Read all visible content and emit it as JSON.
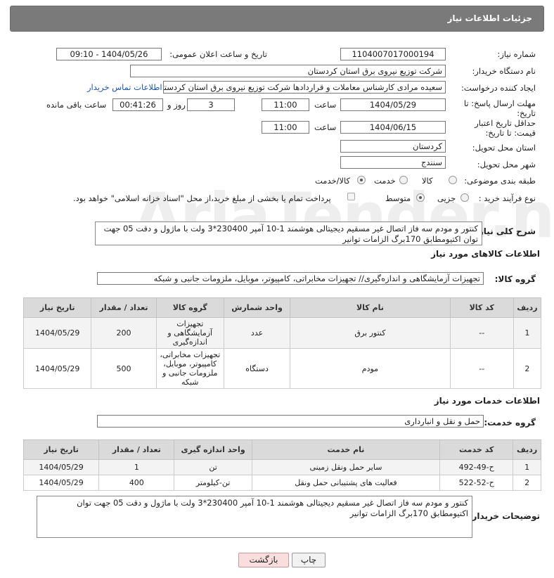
{
  "header": {
    "title": "جزئیات اطلاعات نیاز"
  },
  "form": {
    "need_number_label": "شماره نیاز:",
    "need_number": "1104007017000194",
    "announce_label": "تاریخ و ساعت اعلان عمومی:",
    "announce_value": "1404/05/26 - 09:10",
    "buyer_org_label": "نام دستگاه خریدار:",
    "buyer_org": "شرکت توزیع نیروی برق استان کردستان",
    "requester_label": "ایجاد کننده درخواست:",
    "requester": "سعیده مرادی کارشناس معاملات و قراردادها شرکت توزیع نیروی برق استان کردستان",
    "contact_link": "اطلاعات تماس خریدار",
    "deadline_label": "مهلت ارسال پاسخ: تا تاریخ:",
    "deadline_date": "1404/05/29",
    "time_label": "ساعت",
    "deadline_time": "11:00",
    "days_value": "3",
    "days_label": "روز و",
    "remaining_time": "00:41:26",
    "remaining_label": "ساعت باقی مانده",
    "validity_label": "حداقل تاریخ اعتبار قیمت: تا تاریخ:",
    "validity_date": "1404/06/15",
    "validity_time": "11:00",
    "province_label": "استان محل تحویل:",
    "province": "کردستان",
    "city_label": "شهر محل تحویل:",
    "city": "سنندج",
    "category_label": "طبقه بندی موضوعی:",
    "category_options": [
      "کالا",
      "خدمت",
      "کالا/خدمت"
    ],
    "process_label": "نوع فرآیند خرید :",
    "process_options": [
      "جزیی",
      "متوسط"
    ],
    "payment_note": "پرداخت تمام یا بخشی از مبلغ خرید،از محل \"اسناد خزانه اسلامی\" خواهد بود.",
    "summary_label": "شرح کلی نیاز:",
    "summary": "کنتور  و مودم سه فاز اتصال غیر مسقیم  دیجیتالی  هوشمند 1-10 آمپر 230400*3 ولت با ماژول و  دقت  05 جهت توان اکتیومطابق 170برگ الزامات توانیر"
  },
  "goods": {
    "section_title": "اطلاعات کالاهای مورد نیاز",
    "group_label": "گروه کالا:",
    "group_value": "تجهیزات آزمایشگاهی و اندازه‌گیری// تجهیزات مخابراتی، کامپیوتر، موبایل، ملزومات جانبی و شبکه",
    "columns": [
      "ردیف",
      "کد کالا",
      "نام کالا",
      "واحد شمارش",
      "گروه کالا",
      "تعداد / مقدار",
      "تاریخ نیاز"
    ],
    "rows": [
      [
        "1",
        "--",
        "کنتور برق",
        "عدد",
        "تجهیزات آزمایشگاهی و اندازه‌گیری",
        "200",
        "1404/05/29"
      ],
      [
        "2",
        "--",
        "مودم",
        "دستگاه",
        "تجهیزات مخابراتی، کامپیوتر، موبایل، ملزومات جانبی و شبکه",
        "500",
        "1404/05/29"
      ]
    ]
  },
  "services": {
    "section_title": "اطلاعات خدمات مورد نیاز",
    "group_label": "گروه خدمت:",
    "group_value": "حمل و نقل و انبارداری",
    "columns": [
      "ردیف",
      "کد خدمت",
      "نام خدمت",
      "واحد اندازه گیری",
      "تعداد / مقدار",
      "تاریخ نیاز"
    ],
    "rows": [
      [
        "1",
        "ح-49-492",
        "سایر حمل ونقل زمینی",
        "تن",
        "1",
        "1404/05/29"
      ],
      [
        "2",
        "ح-52-522",
        "فعالیت های پشتیبانی حمل ونقل",
        "تن-کیلومتر",
        "400",
        "1404/05/29"
      ]
    ]
  },
  "buyer_notes_label": "توضیحات خریدار:",
  "buyer_notes": "کنتور  و مودم سه فاز اتصال غیر مسقیم  دیجیتالی  هوشمند 1-10 آمپر 230400*3 ولت با ماژول و  دقت  05 جهت توان اکتیومطابق 170برگ الزامات توانیر",
  "buttons": {
    "print": "چاپ",
    "back": "بازگشت"
  },
  "watermark": "AriaTender.neT",
  "colors": {
    "header_bg": "#7a7a7a",
    "link": "#1a56b4",
    "back_button_bg": "#f9dede"
  }
}
